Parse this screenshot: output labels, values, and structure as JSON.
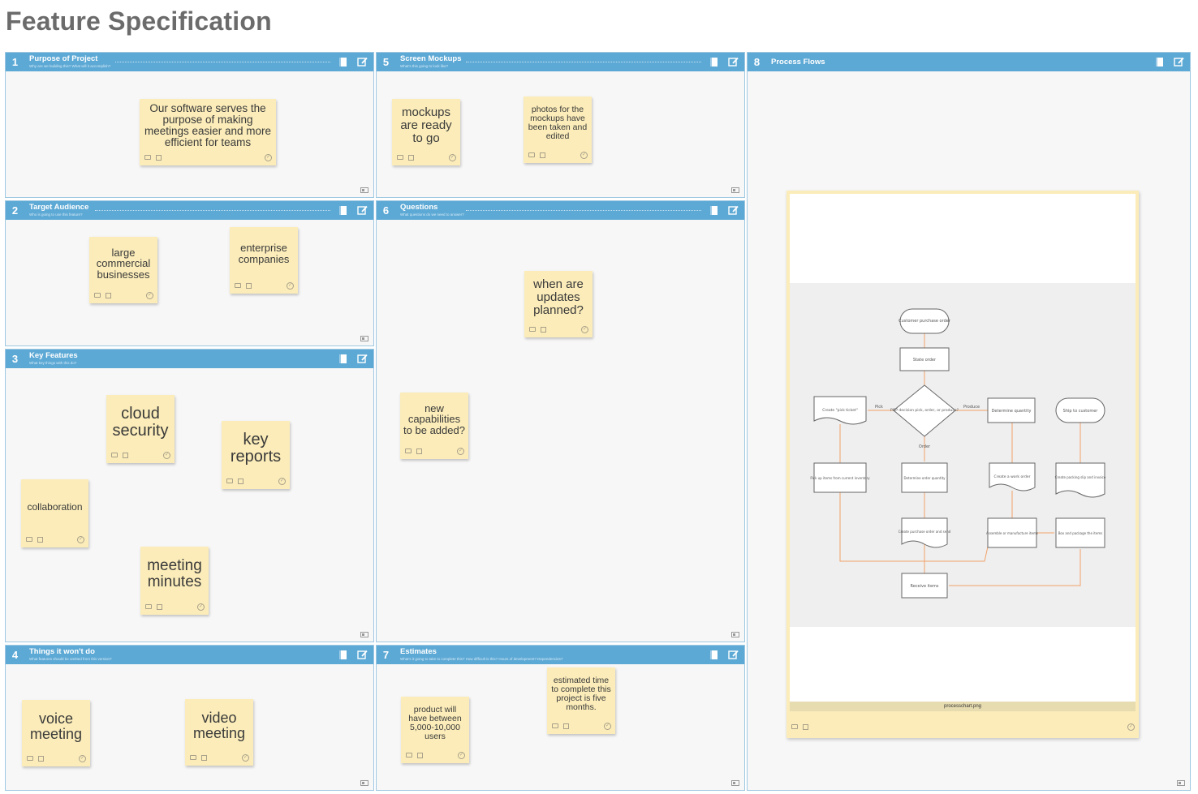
{
  "page": {
    "title": "Feature Specification"
  },
  "sections": {
    "s1": {
      "number": "1",
      "title": "Purpose of Project",
      "subtitle": "Why are we building this? What will it accomplish?"
    },
    "s2": {
      "number": "2",
      "title": "Target Audience",
      "subtitle": "Who is going to use this feature?"
    },
    "s3": {
      "number": "3",
      "title": "Key Features",
      "subtitle": "What key things with this do?"
    },
    "s4": {
      "number": "4",
      "title": "Things it won't do",
      "subtitle": "What features should be omitted from this version?"
    },
    "s5": {
      "number": "5",
      "title": "Screen Mockups",
      "subtitle": "What's this going to look like?"
    },
    "s6": {
      "number": "6",
      "title": "Questions",
      "subtitle": "What questions do we need to answer?"
    },
    "s7": {
      "number": "7",
      "title": "Estimates",
      "subtitle": "What's it going to take to complete this? How difficult is this? Hours of development? Dependencies?"
    },
    "s8": {
      "number": "8",
      "title": "Process Flows"
    }
  },
  "notes": {
    "purpose": "Our software serves the purpose of making meetings easier and more efficient for teams",
    "audience_1": "large commercial businesses",
    "audience_2": "enterprise companies",
    "feature_1": "cloud security",
    "feature_2": "key reports",
    "feature_3": "collaboration",
    "feature_4": "meeting minutes",
    "wont_1": "voice meeting",
    "wont_2": "video meeting",
    "mockup_1": "mockups are ready to go",
    "mockup_2": "photos for the mockups have been taken and edited",
    "question_1": "when are updates planned?",
    "question_2": "new capabilities to be added?",
    "estimate_1": "product will have between 5,000-10,000 users",
    "estimate_2": "estimated time to complete this project is five months."
  },
  "image_card": {
    "caption": "processchart.png",
    "flow": {
      "start": "Customer purchase order",
      "state": "State order",
      "decision": "POP decision pick, order, or produce?",
      "pick_label": "Pick",
      "produce_label": "Produce",
      "order_label": "Order",
      "pick_ticket": "Create \"pick ticket\"",
      "determine_qty": "Determine quantity",
      "ship": "Ship to customer",
      "pick_items": "Pick up items from current inventory",
      "determine_order_qty": "Determine order quantity",
      "work_order": "Create a work order",
      "packing_slip": "Create packing slip and invoice",
      "purchase_send": "Create purchase order and send",
      "assemble": "Assemble or manufacture items",
      "box_package": "Box and package the items",
      "receive": "Receive items"
    }
  },
  "colors": {
    "header_blue": "#5da9d5",
    "note_yellow": "#fbecb9",
    "flow_orange": "#f0a26a"
  }
}
